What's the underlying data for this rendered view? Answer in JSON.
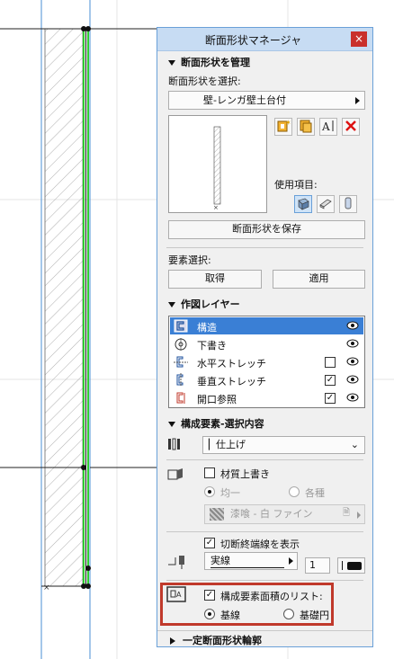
{
  "panel": {
    "title": "断面形状マネージャ",
    "close_glyph": "×"
  },
  "manage": {
    "header": "断面形状を管理",
    "select_label": "断面形状を選択:",
    "selected_profile": "壁-レンガ壁土台付",
    "usage_label": "使用項目:",
    "save_button": "断面形状を保存",
    "element_select_label": "要素選択:",
    "get_button": "取得",
    "apply_button": "適用"
  },
  "layers": {
    "header": "作図レイヤー",
    "items": [
      {
        "label": "構造",
        "checked": null,
        "selected": true
      },
      {
        "label": "下書き",
        "checked": null,
        "selected": false
      },
      {
        "label": "水平ストレッチ",
        "checked": false,
        "selected": false
      },
      {
        "label": "垂直ストレッチ",
        "checked": true,
        "selected": false
      },
      {
        "label": "開口参照",
        "checked": true,
        "selected": false
      }
    ],
    "check_glyph": "✓"
  },
  "components": {
    "header": "構成要素-選択内容",
    "finish_dropdown": "仕上げ",
    "material_override_label": "材質上書き",
    "uniform_label": "均一",
    "each_label": "各種",
    "surface_value": "漆喰 - 白 ファイン",
    "show_cut_end_lines": "切断終端線を表示",
    "line_type": "実線",
    "pen_number": "1",
    "list_area_label": "構成要素面積のリスト:",
    "base_line_label": "基線",
    "base_circle_label": "基礎円"
  },
  "footer": {
    "header": "一定断面形状輪郭"
  },
  "colors": {
    "title_bg": "#c7dcf3",
    "selection": "#3a7fd5",
    "close": "#c9302c",
    "highlight": "#c0392b",
    "wall_green": "#2ecc2e"
  }
}
